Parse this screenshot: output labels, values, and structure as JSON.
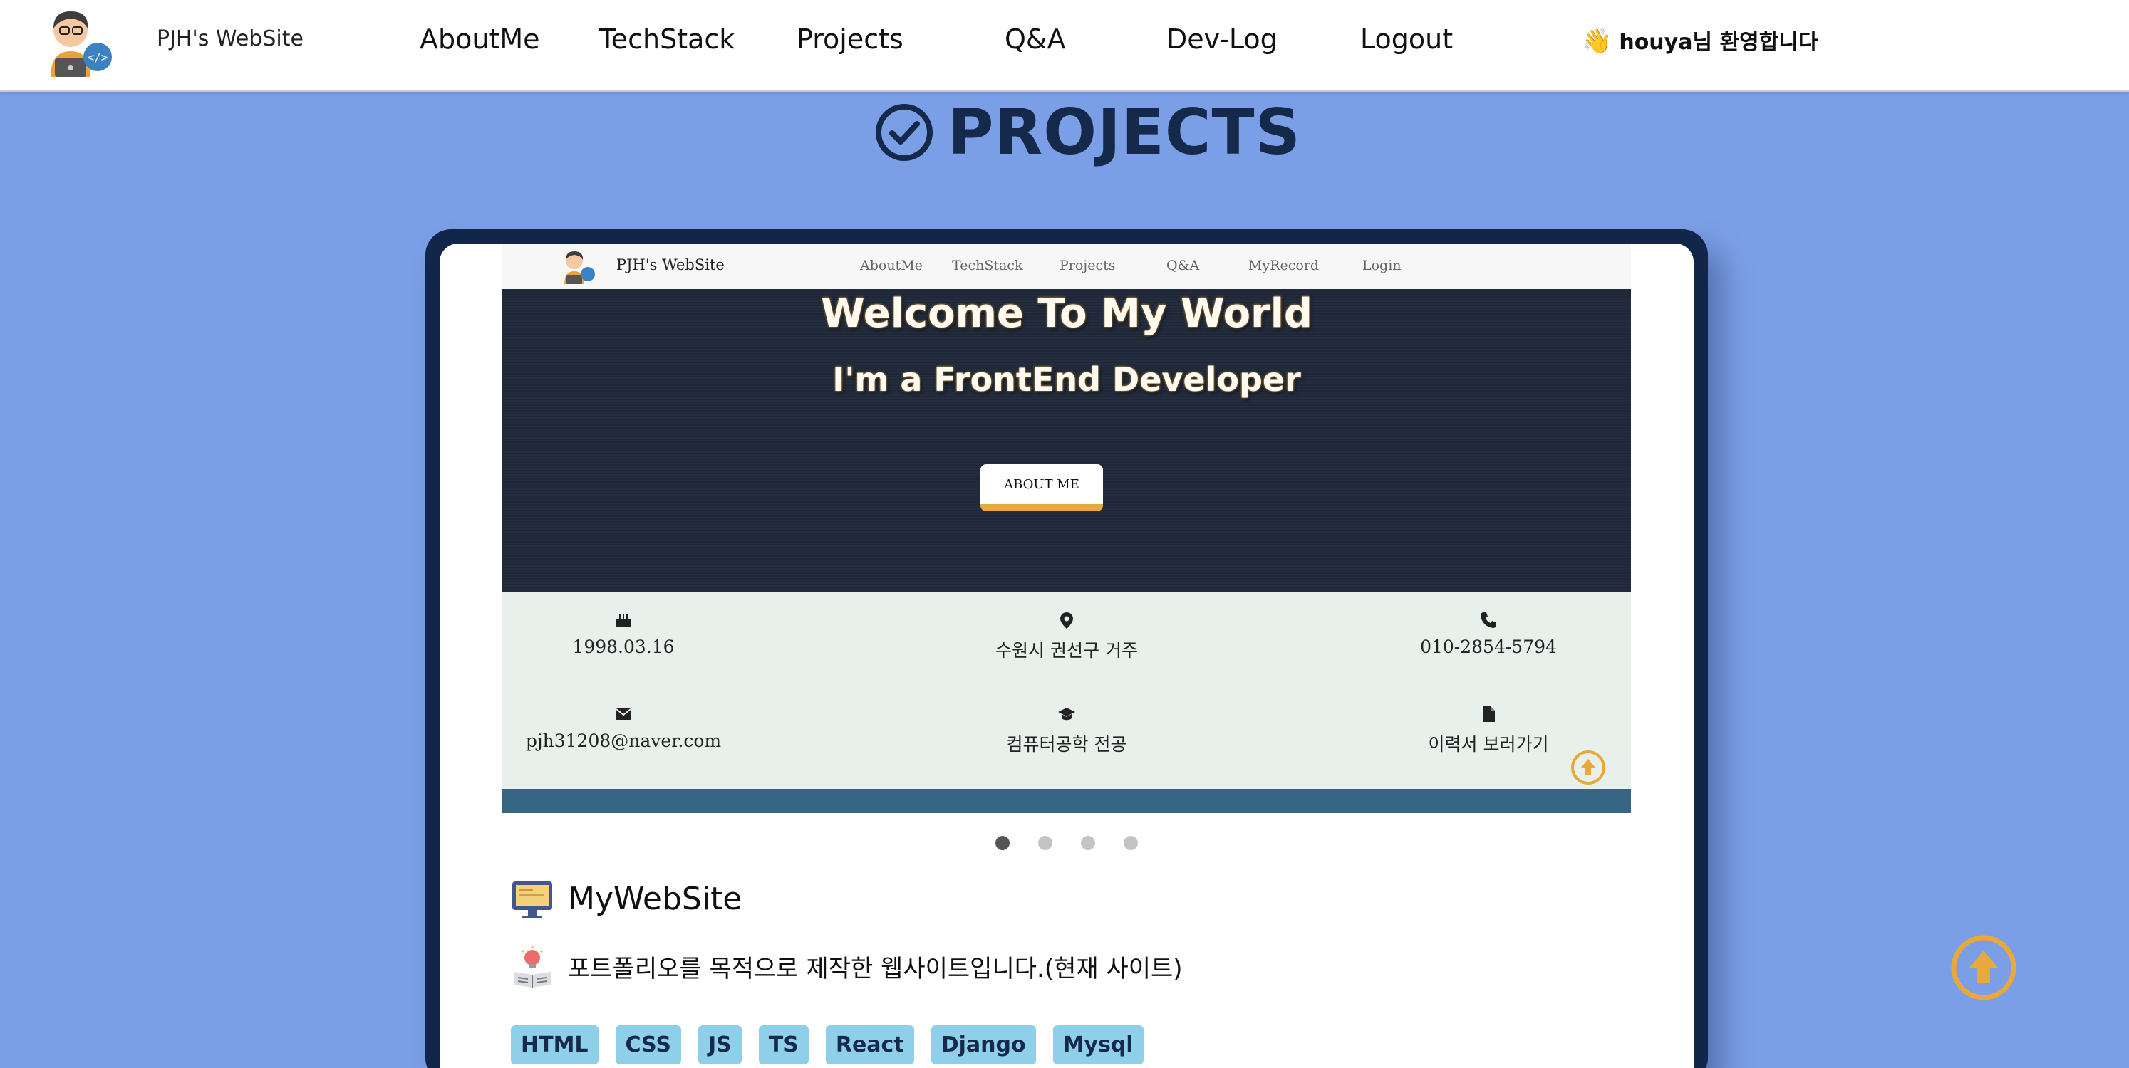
{
  "navbar": {
    "brand": "PJH's WebSite",
    "items": [
      {
        "label": "AboutMe"
      },
      {
        "label": "TechStack"
      },
      {
        "label": "Projects"
      },
      {
        "label": "Q&A"
      },
      {
        "label": "Dev-Log"
      },
      {
        "label": "Logout"
      }
    ],
    "welcome_icon": "👋",
    "welcome_text": "houya님 환영합니다"
  },
  "page": {
    "title": "PROJECTS",
    "title_icon": "check-circle-icon",
    "background_color": "#7b9fe6",
    "frame_color": "#12264a"
  },
  "preview": {
    "brand": "PJH's WebSite",
    "nav_items": [
      {
        "label": "AboutMe"
      },
      {
        "label": "TechStack"
      },
      {
        "label": "Projects"
      },
      {
        "label": "Q&A"
      },
      {
        "label": "MyRecord"
      },
      {
        "label": "Login"
      }
    ],
    "hero_title": "Welcome To My World",
    "hero_subtitle": "I'm a FrontEnd Developer",
    "hero_button": "ABOUT ME",
    "info": [
      {
        "icon": "birthday-cake-icon",
        "text": "1998.03.16"
      },
      {
        "icon": "location-pin-icon",
        "text": "수원시 권선구 거주"
      },
      {
        "icon": "phone-icon",
        "text": "010-2854-5794"
      },
      {
        "icon": "envelope-icon",
        "text": "pjh31208@naver.com"
      },
      {
        "icon": "graduation-cap-icon",
        "text": "컴퓨터공학 전공"
      },
      {
        "icon": "file-icon",
        "text": "이력서 보러가기"
      }
    ],
    "accent_color": "#e9a93a"
  },
  "carousel": {
    "slides": 4,
    "active_index": 0
  },
  "project": {
    "name": "MyWebSite",
    "description": "포트폴리오를 목적으로 제작한 웹사이트입니다.(현재 사이트)",
    "tags": [
      "HTML",
      "CSS",
      "JS",
      "TS",
      "React",
      "Django",
      "Mysql"
    ]
  }
}
